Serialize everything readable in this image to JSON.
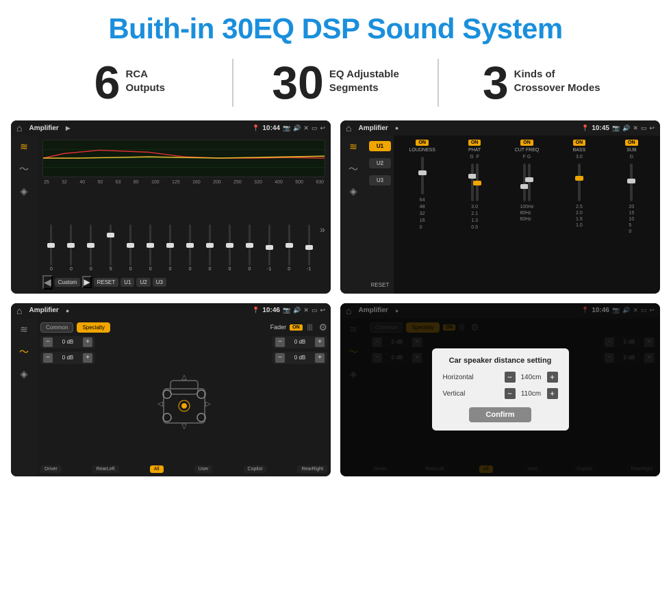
{
  "header": {
    "title": "Buith-in 30EQ DSP Sound System"
  },
  "stats": [
    {
      "number": "6",
      "label": "RCA\nOutputs"
    },
    {
      "number": "30",
      "label": "EQ Adjustable\nSegments"
    },
    {
      "number": "3",
      "label": "Kinds of\nCrossover Modes"
    }
  ],
  "screen1": {
    "title": "Amplifier",
    "time": "10:44",
    "freqs": [
      "25",
      "32",
      "40",
      "50",
      "63",
      "80",
      "100",
      "125",
      "160",
      "200",
      "250",
      "320",
      "400",
      "500",
      "630"
    ],
    "vals": [
      "0",
      "0",
      "0",
      "5",
      "0",
      "0",
      "0",
      "0",
      "0",
      "0",
      "0",
      "-1",
      "0",
      "-1"
    ],
    "buttons": [
      "Custom",
      "RESET",
      "U1",
      "U2",
      "U3"
    ]
  },
  "screen2": {
    "title": "Amplifier",
    "time": "10:45",
    "presets": [
      "U1",
      "U2",
      "U3"
    ],
    "channels": [
      {
        "label": "LOUDNESS",
        "on": true
      },
      {
        "label": "PHAT",
        "on": true
      },
      {
        "label": "CUT FREQ",
        "on": true
      },
      {
        "label": "BASS",
        "on": true
      },
      {
        "label": "SUB",
        "on": true
      }
    ],
    "resetLabel": "RESET"
  },
  "screen3": {
    "title": "Amplifier",
    "time": "10:46",
    "tabs": [
      "Common",
      "Specialty"
    ],
    "faderLabel": "Fader",
    "faderOn": "ON",
    "leftControls": [
      "0 dB",
      "0 dB"
    ],
    "rightControls": [
      "0 dB",
      "0 dB"
    ],
    "bottomBtns": [
      "Driver",
      "RearLeft",
      "All",
      "User",
      "RearRight",
      "Copilot"
    ]
  },
  "screen4": {
    "title": "Amplifier",
    "time": "10:46",
    "tabs": [
      "Common",
      "Specialty"
    ],
    "dialog": {
      "title": "Car speaker distance setting",
      "horizontal": {
        "label": "Horizontal",
        "value": "140cm"
      },
      "vertical": {
        "label": "Vertical",
        "value": "110cm"
      },
      "confirmLabel": "Confirm"
    },
    "bottomBtns": [
      "Driver",
      "RearLeft",
      "All",
      "User",
      "RearRight",
      "Copilot"
    ]
  }
}
